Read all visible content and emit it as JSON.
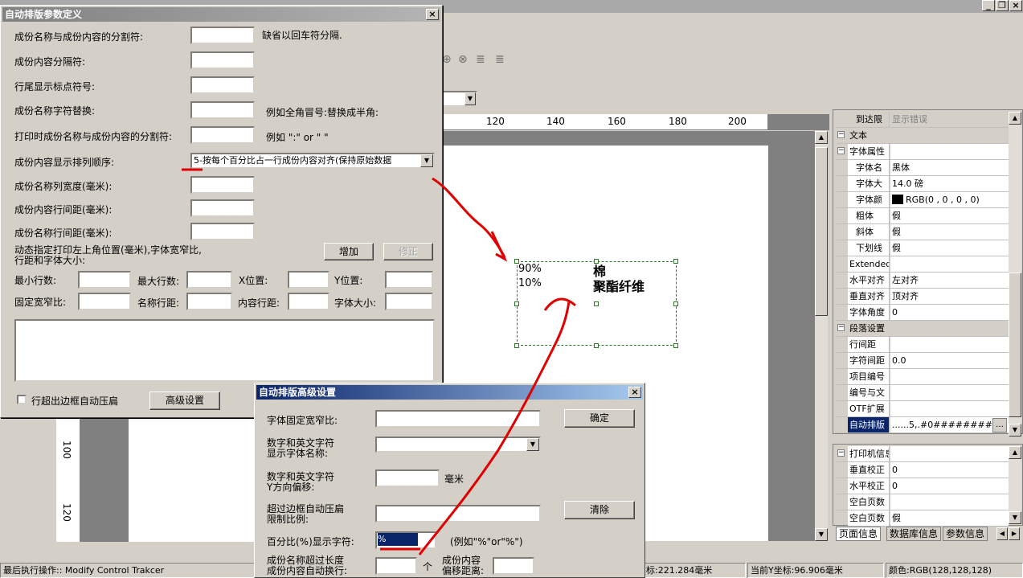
{
  "main_dialog": {
    "title": "自动排版参数定义",
    "rows": {
      "separator_label": "成份名称与成份内容的分割符:",
      "separator_hint": "缺省以回车符分隔.",
      "content_sep_label": "成份内容分隔符:",
      "line_end_label": "行尾显示标点符号:",
      "name_replace_label": "成份名称字符替换:",
      "name_replace_hint": "例如全角冒号:替换成半角:",
      "print_sep_label": "打印时成份名称与成份内容的分割符:",
      "print_sep_hint": "例如 \":\" or \" \"",
      "order_label": "成份内容显示排列顺序:",
      "order_value": "5-按每个百分比占一行成份内容对齐(保持原始数据",
      "name_width_label": "成份名称列宽度(毫米):",
      "content_spacing_label": "成份内容行间距(毫米):",
      "name_spacing_label": "成份名称行间距(毫米):"
    },
    "dynamic_label": "动态指定打印左上角位置(毫米),字体宽窄比,\n行距和字体大小:",
    "add_button": "增加",
    "modify_button": "修正",
    "min_rows": "最小行数:",
    "max_rows": "最大行数:",
    "x_pos": "X位置:",
    "y_pos": "Y位置:",
    "fixed_ratio": "固定宽窄比:",
    "name_spacing": "名称行距:",
    "content_spacing": "内容行距:",
    "font_size": "字体大小:",
    "auto_compress_label": "行超出边框自动压扁",
    "advanced_button": "高级设置"
  },
  "adv_dialog": {
    "title": "自动排版高级设置",
    "font_ratio_label": "字体固定宽窄比:",
    "ok_button": "确定",
    "num_font_label": "数字和英文字符\n显示字体名称:",
    "num_offset_label": "数字和英文字符\nY方向偏移:",
    "mm_unit": "毫米",
    "compress_limit_label": "超过边框自动压扁\n限制比例:",
    "clear_button": "清除",
    "percent_label": "百分比(%)显示字符:",
    "percent_value": "%",
    "percent_hint": "(例如\"%\"or\"%\")",
    "name_overlong_label": "成份名称超过长度\n成份内容自动换行:",
    "ge_unit": "个",
    "content_offset_label": "成份内容\n偏移距离:"
  },
  "canvas": {
    "ruler_ticks": [
      "120",
      "140",
      "160",
      "180",
      "200"
    ],
    "vruler_ticks": [
      "100",
      "120"
    ],
    "label_lines": [
      {
        "pct": "90%",
        "name": "棉"
      },
      {
        "pct": "10%",
        "name": "聚酯纤维"
      }
    ]
  },
  "properties": {
    "rows": [
      {
        "k": "到达限",
        "v": "显示错误",
        "indent": true,
        "grey": true
      },
      {
        "cat": "文本",
        "sign": "−"
      },
      {
        "cat_k": "字体属性",
        "sign": "−"
      },
      {
        "k": "字体名",
        "v": "黑体",
        "indent": true
      },
      {
        "k": "字体大",
        "v": "14.0 磅",
        "indent": true
      },
      {
        "k": "字体颜",
        "v": "RGB(0 , 0 , 0 , 0)",
        "indent": true,
        "swatch": "#000000"
      },
      {
        "k": "粗体",
        "v": "假",
        "indent": true
      },
      {
        "k": "斜体",
        "v": "假",
        "indent": true
      },
      {
        "k": "下划线",
        "v": "假",
        "indent": true
      },
      {
        "k": "Extended",
        "v": ""
      },
      {
        "k": "水平对齐",
        "v": "左对齐"
      },
      {
        "k": "垂直对齐",
        "v": "顶对齐"
      },
      {
        "k": "字体角度",
        "v": "0"
      },
      {
        "cat": "段落设置",
        "sign": "−"
      },
      {
        "k": "行间距",
        "v": ""
      },
      {
        "k": "字符间距",
        "v": "0.0"
      },
      {
        "k": "项目编号",
        "v": ""
      },
      {
        "k": "编号与文",
        "v": ""
      },
      {
        "k": "OTF扩展",
        "v": ""
      },
      {
        "k": "自动排版",
        "v": "......5,.#0########%",
        "selected": true
      }
    ],
    "printer_rows": [
      {
        "cat_k": "打印机信息",
        "sign": "−"
      },
      {
        "k": "垂直校正",
        "v": "0"
      },
      {
        "k": "水平校正",
        "v": "0"
      },
      {
        "k": "空白页数",
        "v": ""
      },
      {
        "k": "空白页数",
        "v": "假"
      }
    ],
    "tabs": [
      "页面信息",
      "数据库信息",
      "参数信息"
    ]
  },
  "status": {
    "last_op": "最后执行操作:: Modify Control Trakcer",
    "x": "标:221.284毫米",
    "y": "当前Y坐标:96.906毫米",
    "color": "颜色:RGB(128,128,128)"
  },
  "colors": {
    "title_active": "#0a246a",
    "title_inactive": "#808080",
    "annotation": "#e00000"
  }
}
